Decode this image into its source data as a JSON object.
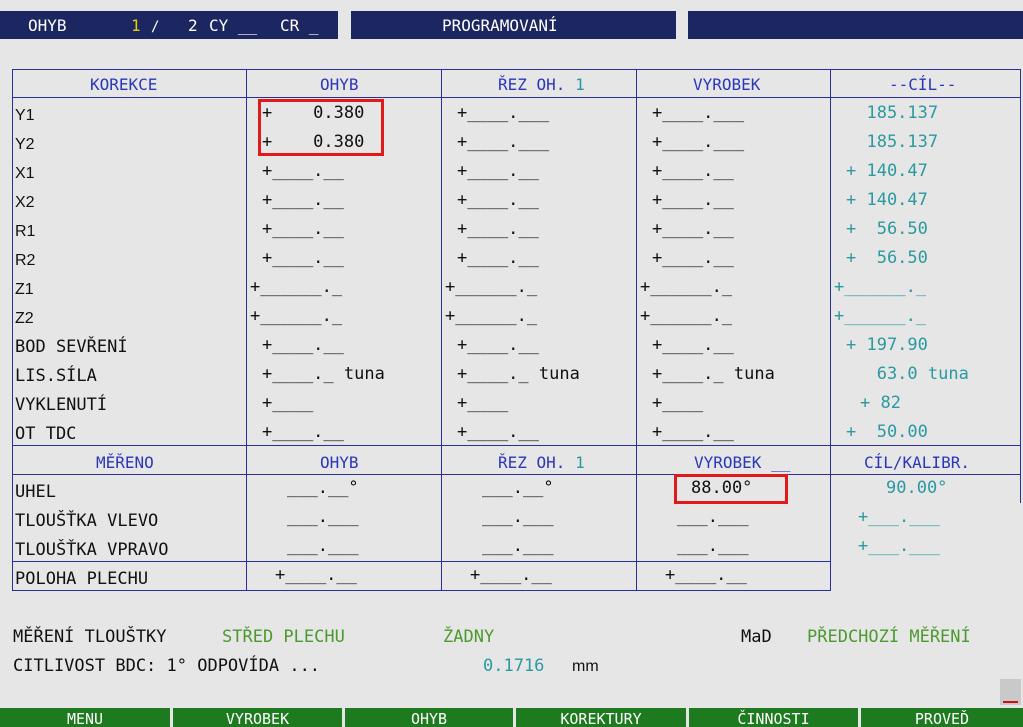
{
  "header": {
    "ohyb_label": "OHYB",
    "ohyb_current": "1",
    "slash": "/",
    "ohyb_total": "2",
    "cy_label": "CY __",
    "cr_label": "CR _",
    "mode_title": "PROGRAMOVANÍ"
  },
  "korekce": {
    "headers": [
      "KOREKCE",
      "OHYB",
      "ŘEZ OH.",
      "VYROBEK",
      "--CÍL--"
    ],
    "rez_num": "1",
    "rows": [
      {
        "label": "Y1",
        "ohyb": "+    0.380",
        "rez": "+____.___",
        "vyrobek": "+____.___",
        "cil": "  185.137"
      },
      {
        "label": "Y2",
        "ohyb": "+    0.380",
        "rez": "+____.___",
        "vyrobek": "+____.___",
        "cil": "  185.137"
      },
      {
        "label": "X1",
        "ohyb": "+____.__",
        "rez": "+____.__",
        "vyrobek": "+____.__",
        "cil": "+ 140.47"
      },
      {
        "label": "X2",
        "ohyb": "+____.__",
        "rez": "+____.__",
        "vyrobek": "+____.__",
        "cil": "+ 140.47"
      },
      {
        "label": "R1",
        "ohyb": "+____.__",
        "rez": "+____.__",
        "vyrobek": "+____.__",
        "cil": "+  56.50"
      },
      {
        "label": "R2",
        "ohyb": "+____.__",
        "rez": "+____.__",
        "vyrobek": "+____.__",
        "cil": "+  56.50"
      },
      {
        "label": "Z1",
        "ohyb": "+______._",
        "rez": "+______._",
        "vyrobek": "+______._",
        "cil": "+______._"
      },
      {
        "label": "Z2",
        "ohyb": "+______._",
        "rez": "+______._",
        "vyrobek": "+______._",
        "cil": "+______._"
      },
      {
        "label": "BOD SEVŘENÍ",
        "ohyb": "+____.__",
        "rez": "+____.__",
        "vyrobek": "+____.__",
        "cil": "+ 197.90"
      },
      {
        "label": "LIS.SÍLA",
        "ohyb": "+____._ tuna",
        "rez": "+____._ tuna",
        "vyrobek": "+____._ tuna",
        "cil": "   63.0 tuna"
      },
      {
        "label": "VYKLENUTÍ",
        "ohyb": "+____",
        "rez": "+____",
        "vyrobek": "+____",
        "cil": "+ 82"
      },
      {
        "label": "OT TDC",
        "ohyb": "+____.__",
        "rez": "+____.__",
        "vyrobek": "+____.__",
        "cil": "+  50.00"
      }
    ]
  },
  "mereno": {
    "headers": [
      "MĚŘENO",
      "OHYB",
      "ŘEZ OH.",
      "VYROBEK __",
      "CÍL/KALIBR."
    ],
    "rez_num": "1",
    "rows": [
      {
        "label": "UHEL",
        "ohyb": "___.__°",
        "rez": "___.__°",
        "vyrobek": "88.00°",
        "cil": "90.00°"
      },
      {
        "label": "TLOUŠŤKA VLEVO",
        "ohyb": "___.___",
        "rez": "___.___",
        "vyrobek": "___.___",
        "cil": "+___.___"
      },
      {
        "label": "TLOUŠŤKA VPRAVO",
        "ohyb": "___.___",
        "rez": "___.___",
        "vyrobek": "___.___",
        "cil": "+___.___"
      },
      {
        "label": "POLOHA PLECHU",
        "ohyb": "+____.__",
        "rez": "+____.__",
        "vyrobek": "+____.__"
      }
    ]
  },
  "footer_info": {
    "mereni_label": "MĚŘENÍ TLOUŠTKY",
    "stred": "STŘED PLECHU",
    "zadny": "ŽADNY",
    "mad": "MaD",
    "predchozi": "PŘEDCHOZÍ MĚŘENÍ",
    "citlivost_label": "CITLIVOST BDC: 1° ODPOVÍDA ...",
    "citlivost_value": "0.1716",
    "citlivost_unit": "mm"
  },
  "softkeys": [
    "MENU",
    "VYROBEK",
    "OHYB",
    "KOREKTURY",
    "ČINNOSTI",
    "PROVEĎ"
  ],
  "colors": {
    "panel": "#1c2660",
    "grid": "#2a2f9c",
    "teal": "#2a9aa0",
    "softkey": "#1e7a1e",
    "highlight": "#e01a1a"
  }
}
